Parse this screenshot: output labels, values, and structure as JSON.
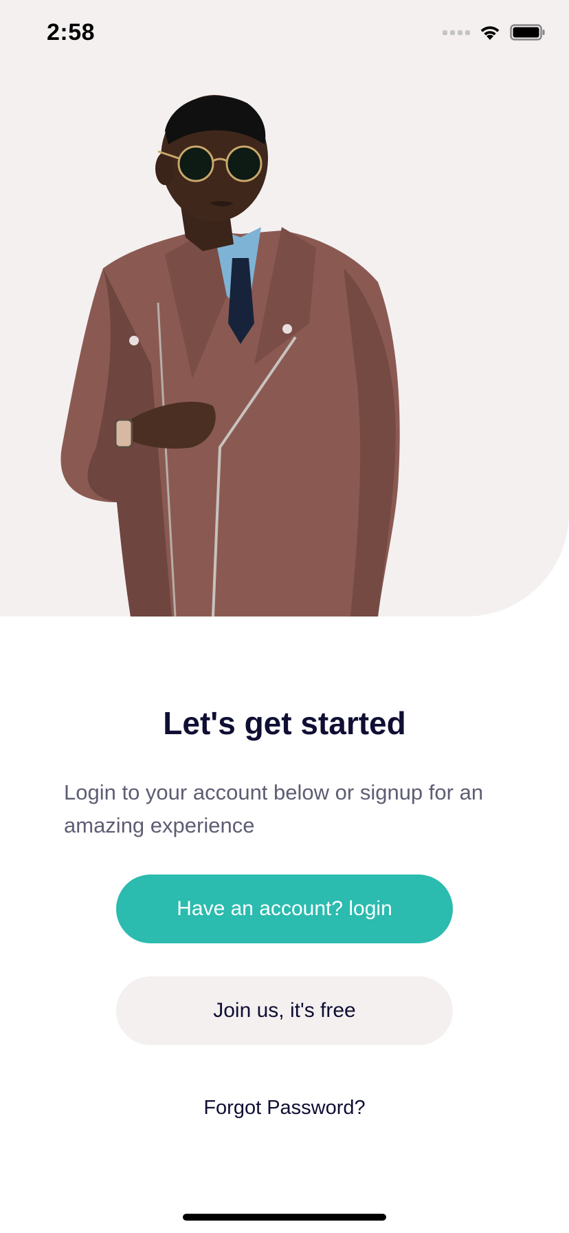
{
  "status_bar": {
    "time": "2:58"
  },
  "hero": {
    "image": "person-in-brown-leather-jacket",
    "background_color": "#f4f0f0"
  },
  "content": {
    "title": "Let's get started",
    "subtitle": "Login to your account below or signup for an amazing experience"
  },
  "buttons": {
    "login_label": "Have an account? login",
    "join_label": "Join us, it's free",
    "forgot_label": "Forgot Password?"
  },
  "colors": {
    "primary": "#2bbbaf",
    "text_dark": "#0f0e33",
    "text_muted": "#5d5d73",
    "surface_light": "#f4f0f0"
  }
}
